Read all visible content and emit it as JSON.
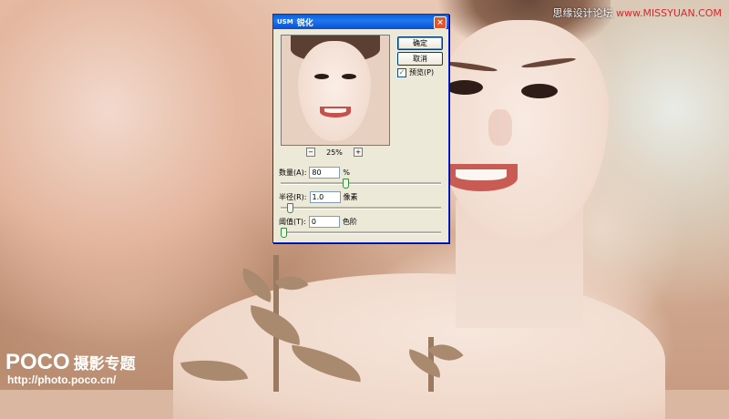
{
  "watermark": {
    "top_text": "思缘设计论坛",
    "top_url": "www.MISSYUAN.COM",
    "logo": "POCO",
    "logo_sub": "摄影专题",
    "url": "http://photo.poco.cn/"
  },
  "dialog": {
    "app_badge": "USM",
    "title": "锐化",
    "close_label": "×",
    "zoom": {
      "minus": "−",
      "level": "25%",
      "plus": "+"
    },
    "ok_label": "确定",
    "cancel_label": "取消",
    "preview_label": "预览(P)",
    "preview_checked": "✓",
    "amount": {
      "label": "数量(A):",
      "value": "80",
      "unit": "%",
      "slider_fraction": 0.4
    },
    "radius": {
      "label": "半径(R):",
      "value": "1.0",
      "unit": "像素",
      "slider_fraction": 0.04
    },
    "threshold": {
      "label": "阈值(T):",
      "value": "0",
      "unit": "色阶",
      "slider_fraction": 0.0
    }
  },
  "colors": {
    "titlebar": "#0a5fdc",
    "dialog_bg": "#ece9d8",
    "watermark_red": "#e0242b"
  }
}
